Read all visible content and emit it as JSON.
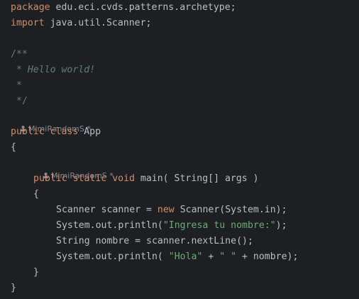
{
  "code": {
    "package_kw": "package",
    "package_name": " edu.eci.cvds.patterns.archetype;",
    "import_kw": "import",
    "import_name": " java.util.Scanner;",
    "doc_open": "/**",
    "doc_line1": " * Hello world!",
    "doc_line2": " *",
    "doc_close": " */",
    "class_author": "MimiRandomS *",
    "class_public": "public",
    "class_class": "class",
    "class_name": " App",
    "class_open_brace": "{",
    "method_author": "MimiRandomS *",
    "method_public": "public",
    "method_static": "static",
    "method_void": "void",
    "method_sig": " main( String[] args )",
    "method_open_brace": "{",
    "l1_a": "Scanner scanner = ",
    "l1_new": "new",
    "l1_b": " Scanner(System.in);",
    "l2_a": "System.out.println(",
    "l2_str": "\"Ingresa tu nombre:\"",
    "l2_b": ");",
    "l3": "String nombre = scanner.nextLine();",
    "l4_a": "System.out.println( ",
    "l4_str1": "\"Hola\"",
    "l4_b": " + ",
    "l4_str2": "\" \"",
    "l4_c": " + nombre);",
    "method_close_brace": "}",
    "class_close_brace": "}"
  },
  "colors": {
    "background": "#1e1f22",
    "keyword": "#cf8e6d",
    "string": "#6aab73",
    "doc_comment": "#5f826b",
    "text": "#bcbec4",
    "inlay_hint": "#868a91"
  }
}
